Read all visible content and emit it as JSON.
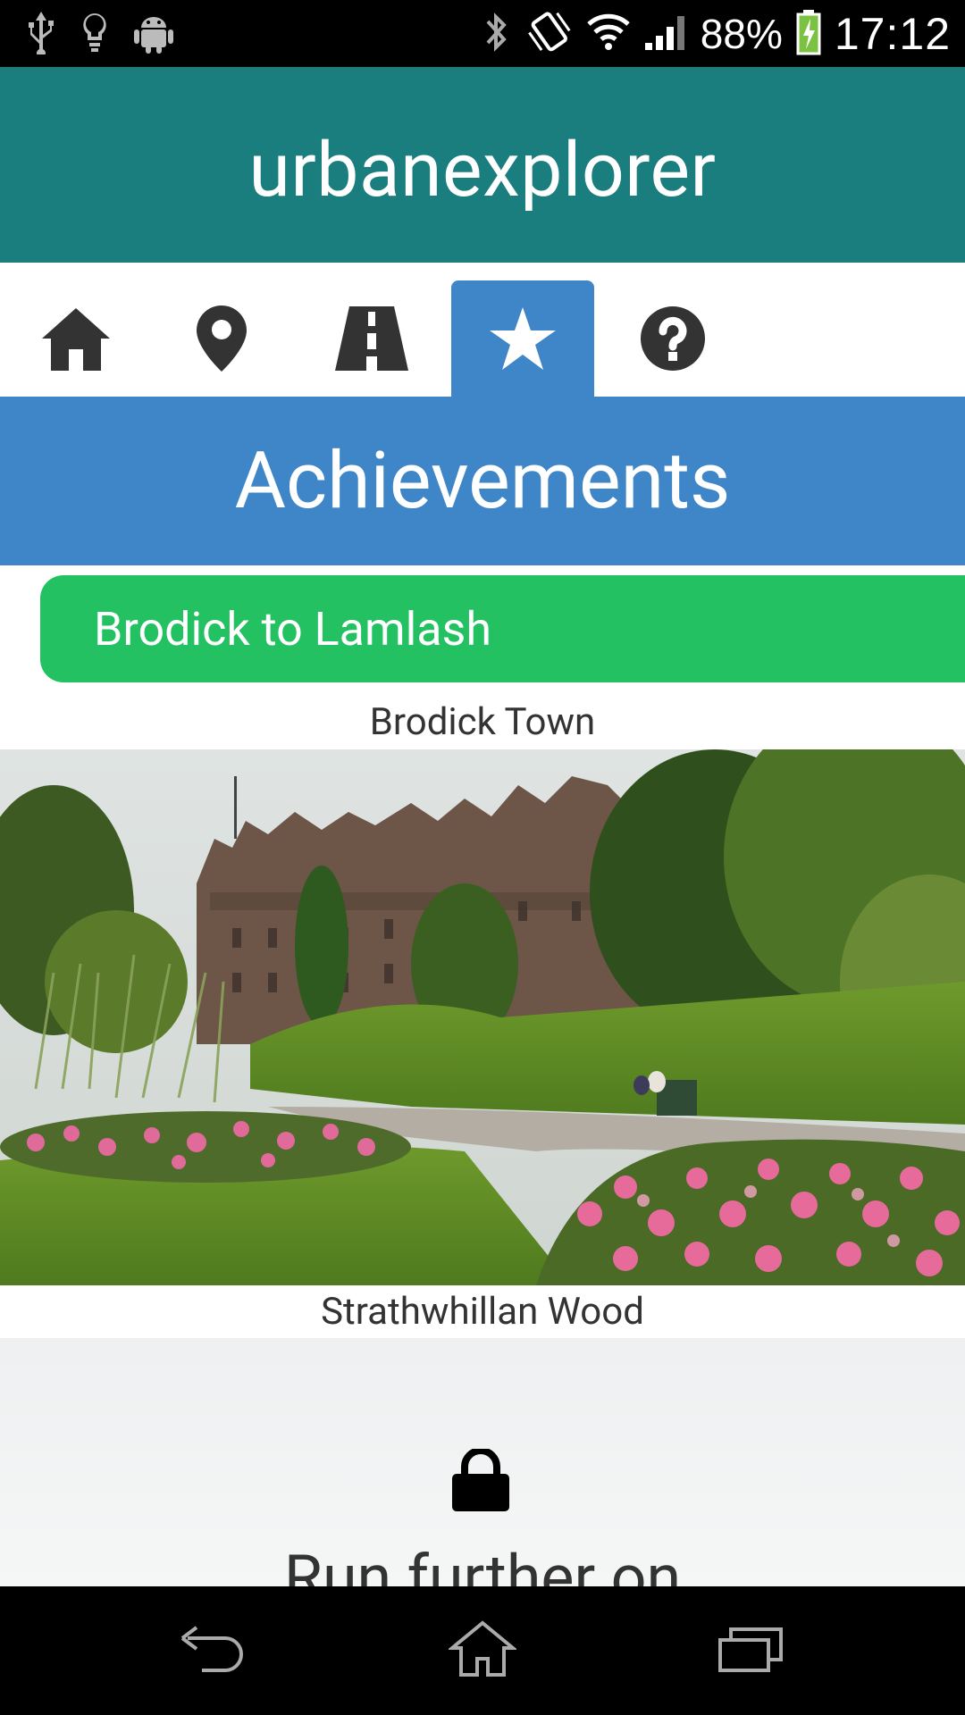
{
  "status_bar": {
    "battery": "88%",
    "time": "17:12",
    "icons": [
      "usb-icon",
      "lightbulb-icon",
      "android-icon",
      "bluetooth-icon",
      "vibrate-icon",
      "wifi-icon",
      "signal-icon",
      "battery-charging-icon"
    ]
  },
  "app": {
    "title": "urbanexplorer"
  },
  "tabs": [
    {
      "icon": "home-icon",
      "active": false
    },
    {
      "icon": "map-pin-icon",
      "active": false
    },
    {
      "icon": "road-icon",
      "active": false
    },
    {
      "icon": "star-icon",
      "active": true
    },
    {
      "icon": "help-icon",
      "active": false
    }
  ],
  "section": {
    "title": "Achievements"
  },
  "route": {
    "label": "Brodick to Lamlash"
  },
  "achievements": [
    {
      "name": "Brodick Town",
      "unlocked": true,
      "image": "castle-garden-photo"
    },
    {
      "name": "Strathwhillan Wood",
      "unlocked": false,
      "locked_message": "Run further on"
    }
  ],
  "nav_bar": {
    "icons": [
      "back-icon",
      "home-outline-icon",
      "recents-icon"
    ]
  },
  "colors": {
    "header": "#1a7d7e",
    "accent_blue": "#3f86c9",
    "route_green": "#24c163"
  }
}
